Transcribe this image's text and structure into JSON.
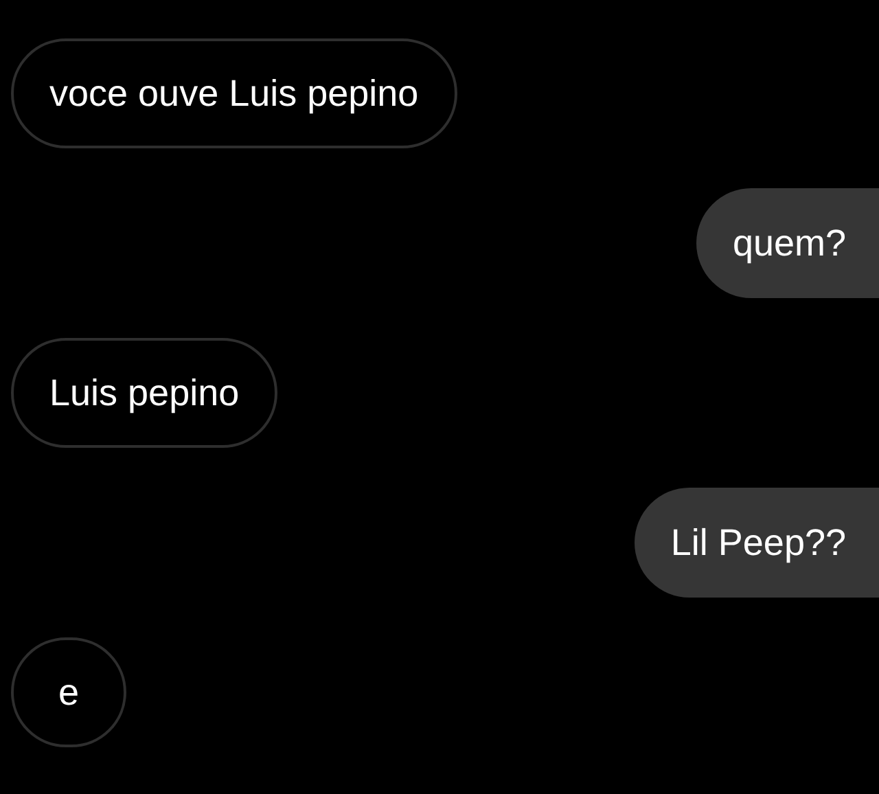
{
  "messages": [
    {
      "kind": "received",
      "text": "voce ouve Luis pepino"
    },
    {
      "kind": "sent",
      "text": "quem?"
    },
    {
      "kind": "received",
      "text": "Luis pepino"
    },
    {
      "kind": "sent",
      "text": "Lil Peep??"
    },
    {
      "kind": "received",
      "text": "e"
    }
  ]
}
